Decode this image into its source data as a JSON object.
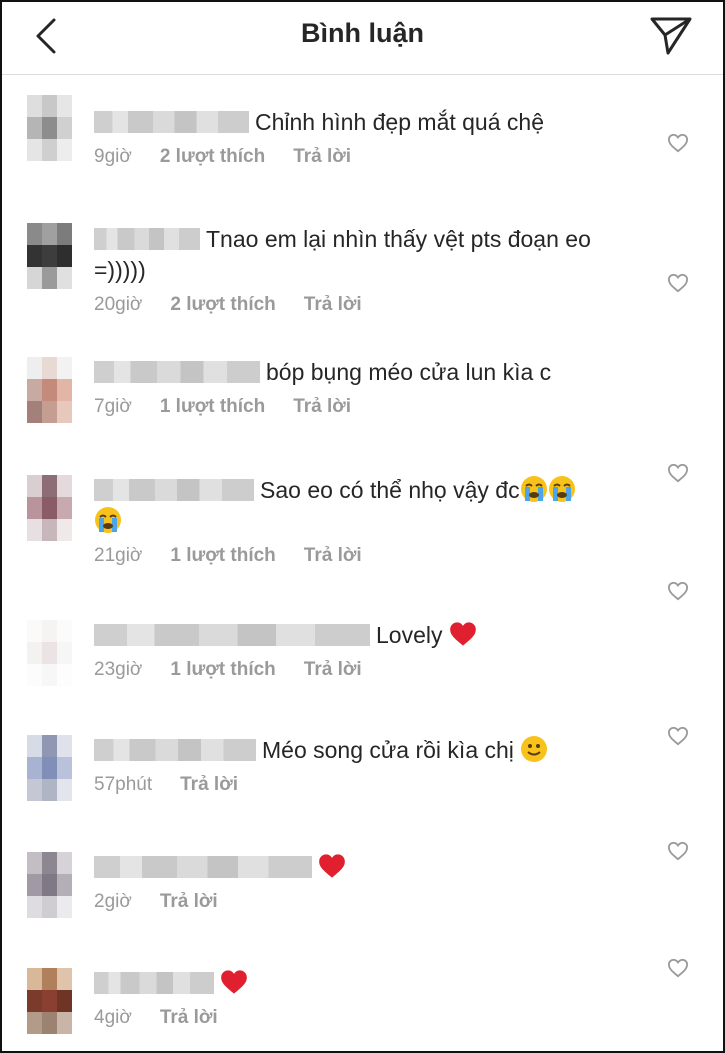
{
  "header": {
    "title": "Bình luận",
    "back_icon": "chevron-left-icon",
    "send_icon": "paper-plane-icon"
  },
  "comments": [
    {
      "text": "Chỉnh hình đẹp mắt quá chệ",
      "time": "9giờ",
      "likes": "2 lượt thích",
      "reply": "Trả lời"
    },
    {
      "text": "Tnao em lại nhìn thấy vệt pts đoạn eo",
      "text2": "=)))))",
      "time": "20giờ",
      "likes": "2 lượt thích",
      "reply": "Trả lời"
    },
    {
      "text": "bóp bụng méo cửa lun kìa c",
      "time": "7giờ",
      "likes": "1 lượt thích",
      "reply": "Trả lời"
    },
    {
      "text": "Sao eo có thể nhọ vậy đc",
      "time": "21giờ",
      "likes": "1 lượt thích",
      "reply": "Trả lời"
    },
    {
      "text": "Lovely",
      "time": "23giờ",
      "likes": "1 lượt thích",
      "reply": "Trả lời"
    },
    {
      "text": "Méo song cửa rồi kìa chị",
      "time": "57phút",
      "reply": "Trả lời"
    },
    {
      "text": "",
      "time": "2giờ",
      "reply": "Trả lời"
    },
    {
      "text": "",
      "time": "4giờ",
      "reply": "Trả lời"
    }
  ],
  "colors": {
    "text": "#262626",
    "meta": "#9a9a9a",
    "heart": "#e0202e"
  }
}
